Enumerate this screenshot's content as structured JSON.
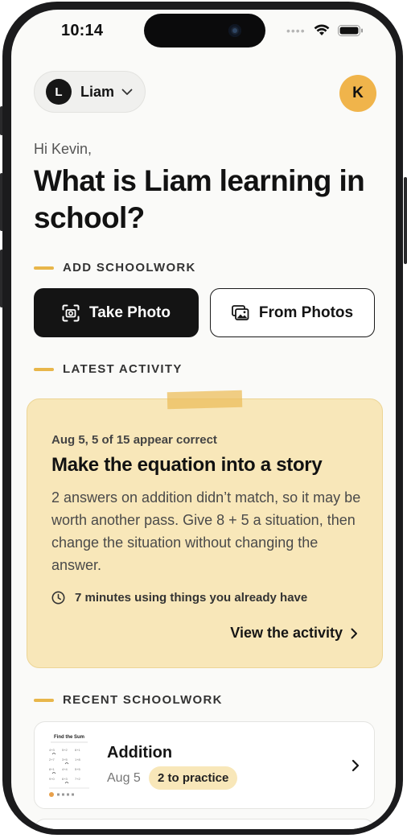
{
  "status_bar": {
    "time": "10:14"
  },
  "header": {
    "child": {
      "initial": "L",
      "name": "Liam"
    },
    "user": {
      "initial": "K"
    }
  },
  "hero": {
    "greeting": "Hi Kevin,",
    "headline": "What is Liam learning in school?"
  },
  "add_schoolwork": {
    "section_label": "ADD SCHOOLWORK",
    "take_photo_label": "Take Photo",
    "from_photos_label": "From Photos"
  },
  "latest_activity": {
    "section_label": "LATEST ACTIVITY",
    "meta": "Aug 5, 5 of 15 appear correct",
    "title": "Make the equation into a story",
    "body": "2 answers on addition didn’t match, so it may be worth another pass. Give 8 + 5 a situation, then change the situation without changing the answer.",
    "duration": "7 minutes using things you already have",
    "link_label": "View the activity"
  },
  "recent_schoolwork": {
    "section_label": "RECENT SCHOOLWORK",
    "items": [
      {
        "title": "Addition",
        "date": "Aug 5",
        "badge": "2 to practice",
        "thumbnail_title": "Find the Sum"
      }
    ]
  },
  "colors": {
    "accent": "#e8b64a",
    "card_bg": "#f8e7b9",
    "avatar": "#f0b44b",
    "primary_button": "#141414"
  },
  "icons": {
    "take_photo": "camera-viewfinder-icon",
    "from_photos": "photo-gallery-icon",
    "duration": "clock-icon",
    "link": "chevron-right-icon",
    "child_selector": "chevron-down-icon"
  }
}
